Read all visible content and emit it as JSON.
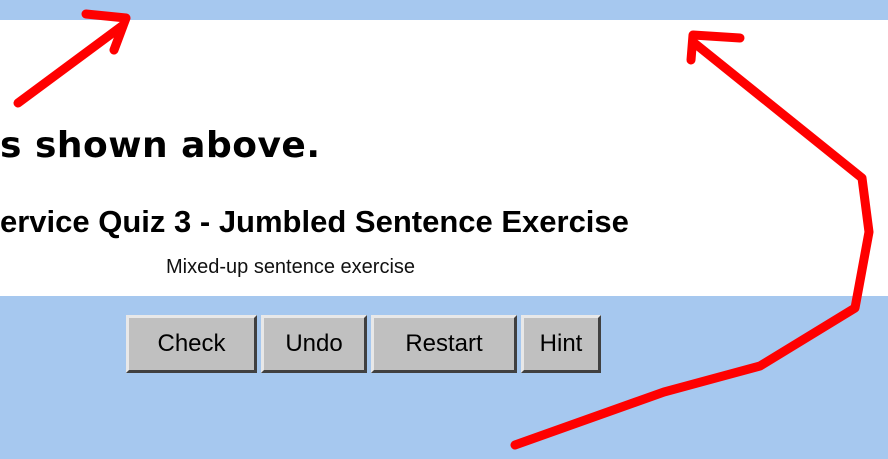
{
  "content": {
    "heading": "s shown above.",
    "quiz_title": "ervice Quiz 3 - Jumbled Sentence Exercise",
    "subtitle": "Mixed-up sentence exercise"
  },
  "buttons": {
    "check": "Check",
    "undo": "Undo",
    "restart": "Restart",
    "hint": "Hint"
  },
  "colors": {
    "background": "#a6c8ef",
    "panel": "#ffffff",
    "button_face": "#c0c0c0",
    "annotation_arrows": "#ff0000"
  },
  "icons": [
    "arrow-annotation-icon"
  ]
}
